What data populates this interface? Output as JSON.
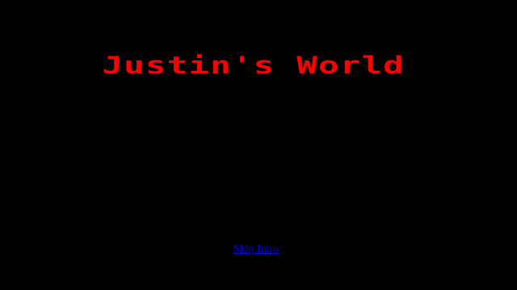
{
  "intro": {
    "title": "Justin's World",
    "skip_label": "Skip Intro"
  },
  "colors": {
    "background": "#000000",
    "title": "#ff0000",
    "link": "#0000ee"
  }
}
